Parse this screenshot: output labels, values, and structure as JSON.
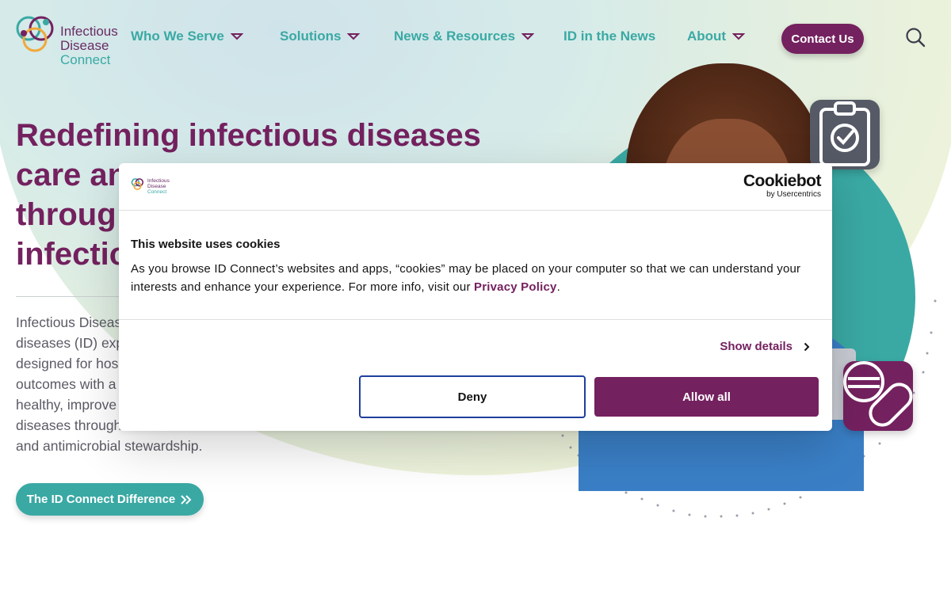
{
  "brand": {
    "logo_line1": "Infectious",
    "logo_line2": "Disease",
    "logo_line3": "Connect",
    "primary_color": "#74215f",
    "accent_color": "#3aa9a4"
  },
  "nav": {
    "items": [
      {
        "label": "Who We Serve",
        "has_dropdown": true
      },
      {
        "label": "Solutions",
        "has_dropdown": true
      },
      {
        "label": "News & Resources",
        "has_dropdown": true
      },
      {
        "label": "ID in the News",
        "has_dropdown": false
      },
      {
        "label": "About",
        "has_dropdown": true
      }
    ],
    "contact_label": "Contact Us",
    "search_icon": "search-icon"
  },
  "hero": {
    "title_lines": [
      "Redefining infectious diseases",
      "care an",
      "throug",
      "infectio"
    ],
    "body_lines": [
      "Infectious Diseas",
      "diseases (ID) exp",
      "designed for hos",
      "outcomes with a",
      "healthy, improve",
      "diseases through",
      "and antimicrobial stewardship."
    ],
    "cta_label": "The ID Connect Difference"
  },
  "cookie_banner": {
    "provider_name": "Cookiebot",
    "provider_sub": "by Usercentrics",
    "title": "This website uses cookies",
    "text_before_link": "As you browse ID Connect’s websites and apps, “cookies” may be placed on your computer so that we can understand your interests and enhance your experience. For more info, visit our ",
    "link_label": "Privacy Policy",
    "text_after_link": ".",
    "show_details_label": "Show details",
    "deny_label": "Deny",
    "allow_label": "Allow all"
  }
}
